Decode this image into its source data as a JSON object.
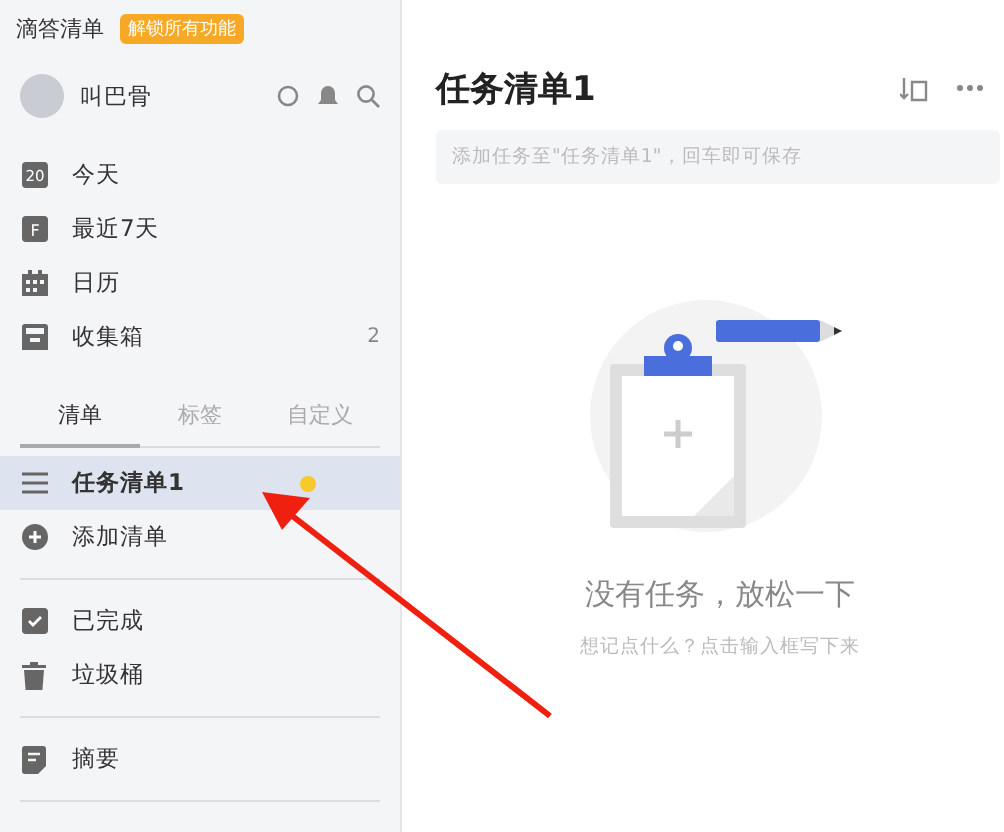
{
  "app": {
    "name": "滴答清单",
    "badge": "解锁所有功能"
  },
  "user": {
    "name": "叫巴骨"
  },
  "nav": [
    {
      "kind": "today",
      "label": "今天",
      "icon_text": "20"
    },
    {
      "kind": "week",
      "label": "最近7天",
      "icon_text": "F"
    },
    {
      "kind": "calendar",
      "label": "日历"
    },
    {
      "kind": "inbox",
      "label": "收集箱",
      "count": "2"
    }
  ],
  "tabs": [
    {
      "label": "清单",
      "selected": true
    },
    {
      "label": "标签",
      "selected": false
    },
    {
      "label": "自定义",
      "selected": false
    }
  ],
  "lists": [
    {
      "kind": "list",
      "label": "任务清单1",
      "selected": true,
      "color": "#f8c92c"
    },
    {
      "kind": "add",
      "label": "添加清单",
      "selected": false
    }
  ],
  "bottom": [
    {
      "kind": "done",
      "label": "已完成"
    },
    {
      "kind": "trash",
      "label": "垃圾桶"
    }
  ],
  "extra": [
    {
      "kind": "summary",
      "label": "摘要"
    }
  ],
  "main": {
    "title": "任务清单1",
    "input": {
      "placeholder": "添加任务至\"任务清单1\"，回车即可保存"
    },
    "empty_title": "没有任务，放松一下",
    "empty_hint": "想记点什么？点击输入框写下来"
  }
}
